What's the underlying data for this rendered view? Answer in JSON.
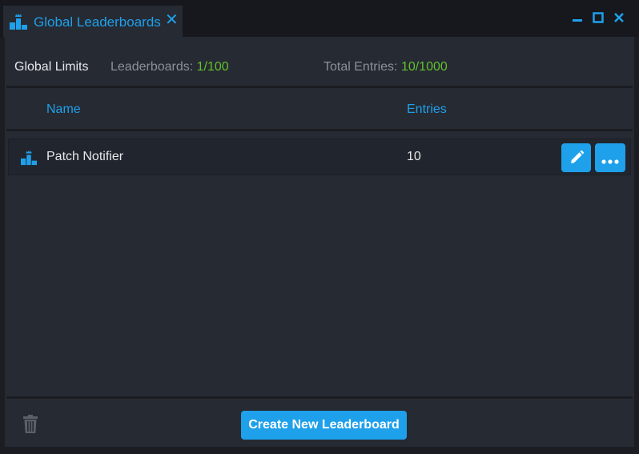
{
  "tab": {
    "title": "Global Leaderboards",
    "icon": "leaderboard-icon",
    "close_icon": "close-icon"
  },
  "window_controls": [
    "minimize-icon",
    "maximize-icon",
    "close-icon"
  ],
  "limits": {
    "title": "Global Limits",
    "leaderboards_label": "Leaderboards:",
    "leaderboards_value": "1/100",
    "entries_label": "Total Entries:",
    "entries_value": "10/1000"
  },
  "table": {
    "columns": [
      "Name",
      "Entries"
    ],
    "rows": [
      {
        "name": "Patch Notifier",
        "entries": "10",
        "icon": "leaderboard-icon",
        "actions": [
          "edit-pencil-icon",
          "more-options-icon"
        ]
      }
    ]
  },
  "footer": {
    "delete_icon": "trash-icon",
    "create_label": "Create New Leaderboard"
  },
  "colors": {
    "accent": "#1fa0ea",
    "value_green": "#63c12a",
    "panel": "#262a33",
    "background": "#1b1d23"
  }
}
